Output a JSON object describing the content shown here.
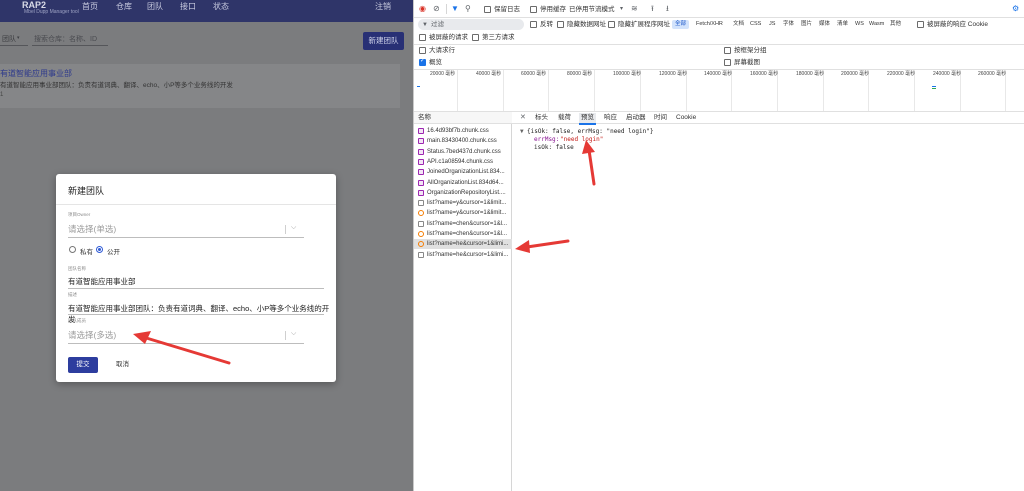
{
  "app": {
    "logo": "RAP2",
    "logo_sub": "Mbel Dupp Manager tool",
    "nav": [
      "首页",
      "仓库",
      "团队",
      "接口",
      "状态"
    ],
    "logout": "注销",
    "filter_label": "团队",
    "search_placeholder": "搜索仓库：名称、ID",
    "new_team_btn": "新建团队",
    "team_card": {
      "title": "有道智能应用事业部",
      "desc": "有道智能应用事业部团队：负责有道词典、翻译、echo、小P等多个业务线的开发",
      "meta": "1"
    }
  },
  "modal": {
    "title": "新建团队",
    "owner_label": "项目Owner",
    "owner_placeholder": "请选择(单选)",
    "visibility": [
      {
        "label": "私有",
        "checked": false
      },
      {
        "label": "公开",
        "checked": true
      }
    ],
    "name_label": "团队名称",
    "name_value": "有道智能应用事业部",
    "desc_label": "描述",
    "desc_value": "有道智能应用事业部团队：负责有道词典、翻译、echo、小P等多个业务线的开发",
    "members_label": "团队成员",
    "members_placeholder": "请选择(多选)",
    "submit": "提交",
    "cancel": "取消"
  },
  "devtools": {
    "toolbar1": {
      "preserve_log": "保留日志",
      "disable_cache": "停用缓存",
      "throttle": "已停用节流模式",
      "icons": [
        "record-icon",
        "clear-icon",
        "filter-icon",
        "search-icon",
        "wifi-icon",
        "upload-icon",
        "download-icon",
        "settings-icon"
      ]
    },
    "filter_placeholder": "过滤",
    "invert": "反转",
    "hide_data_urls": "隐藏数据网址",
    "hide_ext_urls": "隐藏扩展程序网址",
    "type_chips": [
      "全部",
      "Fetch/XHR",
      "文档",
      "CSS",
      "JS",
      "字体",
      "图片",
      "媒体",
      "清单",
      "WS",
      "Wasm",
      "其他"
    ],
    "blocked_cookies": "被屏蔽的响应 Cookie",
    "blocked_requests": "被屏蔽的请求",
    "third_party": "第三方请求",
    "opts": {
      "big_rows": "大请求行",
      "group_by_frame": "按框架分组",
      "overview": "概览",
      "screenshots": "屏幕截图"
    },
    "timeline_ticks": [
      "20000 毫秒",
      "40000 毫秒",
      "60000 毫秒",
      "80000 毫秒",
      "100000 毫秒",
      "120000 毫秒",
      "140000 毫秒",
      "160000 毫秒",
      "180000 毫秒",
      "200000 毫秒",
      "220000 毫秒",
      "240000 毫秒",
      "260000 毫秒"
    ],
    "list_header": "名称",
    "requests": [
      {
        "name": "16.4d93bf7b.chunk.css",
        "type": "css"
      },
      {
        "name": "main.83430400.chunk.css",
        "type": "css"
      },
      {
        "name": "Status.7bed437d.chunk.css",
        "type": "css"
      },
      {
        "name": "API.c1a08594.chunk.css",
        "type": "css"
      },
      {
        "name": "JoinedOrganizationList.834...",
        "type": "css"
      },
      {
        "name": "AllOrganizationList.834d64...",
        "type": "css"
      },
      {
        "name": "OrganizationRepositoryList....",
        "type": "css"
      },
      {
        "name": "list?name=y&cursor=1&limit...",
        "type": "doc"
      },
      {
        "name": "list?name=y&cursor=1&limit...",
        "type": "xhr"
      },
      {
        "name": "list?name=chen&cursor=1&l...",
        "type": "doc"
      },
      {
        "name": "list?name=chen&cursor=1&l...",
        "type": "xhr"
      },
      {
        "name": "list?name=he&cursor=1&limi...",
        "type": "xhr"
      },
      {
        "name": "list?name=he&cursor=1&limi...",
        "type": "doc"
      }
    ],
    "tabs": [
      "标头",
      "载荷",
      "预览",
      "响应",
      "启动器",
      "时间",
      "Cookie"
    ],
    "preview": {
      "summary": "{isOk: false, errMsg: \"need login\"}",
      "line1_key": "errMsg: ",
      "line1_val": "\"need login\"",
      "line2": "isOk: false"
    }
  },
  "colors": {
    "app_nav": "#2f3569",
    "overlay": "#7a7b7d",
    "primary_btn": "#283075",
    "devtools_accent": "#1a73e8",
    "annotation_arrow": "#e53935"
  }
}
